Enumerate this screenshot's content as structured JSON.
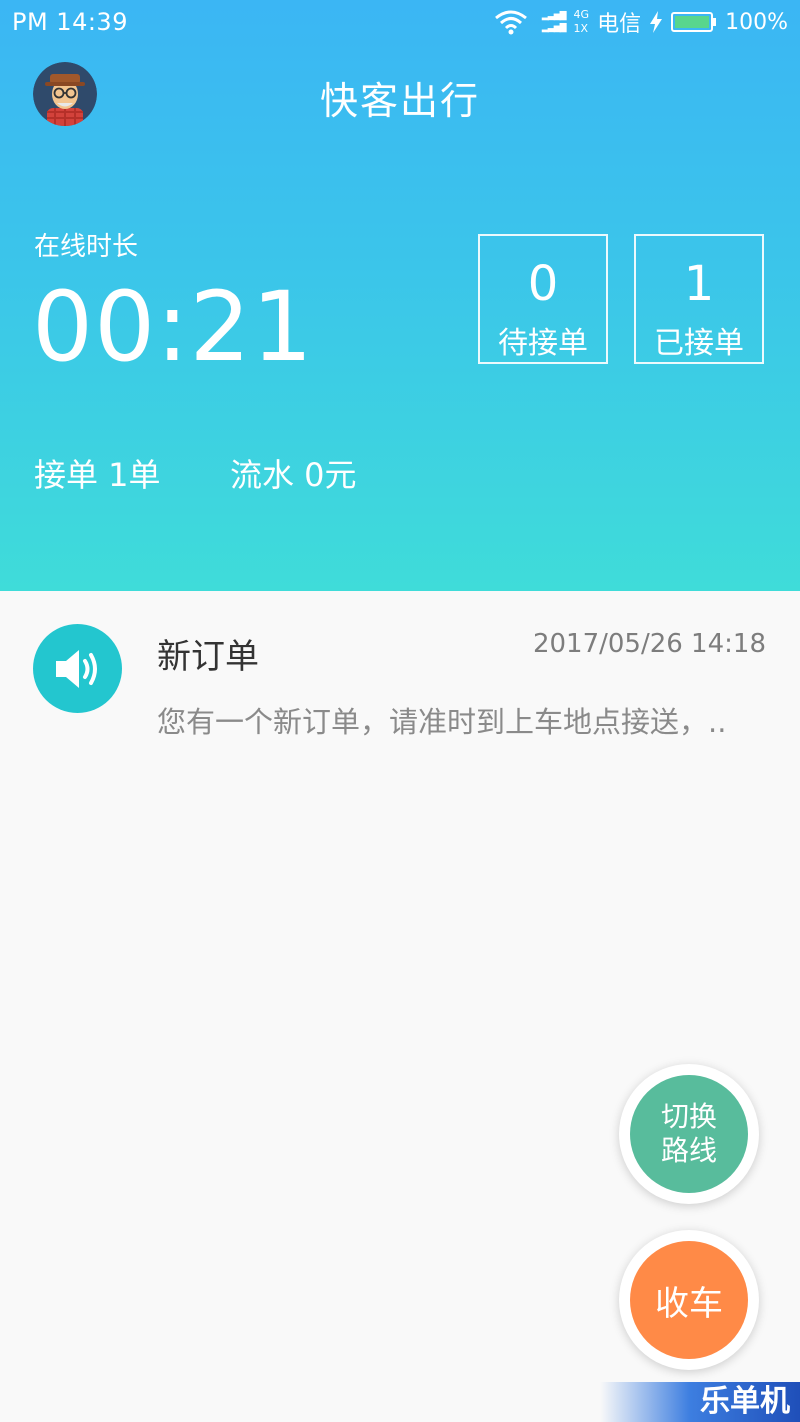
{
  "status_bar": {
    "time": "PM  14:39",
    "network_top": "4G",
    "network_bottom": "1X",
    "carrier": "电信",
    "battery": "100%"
  },
  "header": {
    "title": "快客出行",
    "online_label": "在线时长",
    "online_time": "00:21",
    "stats": [
      {
        "value": "0",
        "label": "待接单"
      },
      {
        "value": "1",
        "label": "已接单"
      }
    ],
    "orders_summary": "接单 1单",
    "flow_summary": "流水 0元"
  },
  "messages": [
    {
      "icon": "speaker-icon",
      "title": "新订单",
      "time": "2017/05/26 14:18",
      "body": "您有一个新订单，请准时到上车地点接送，.."
    }
  ],
  "buttons": {
    "switch_route": "切换\n路线",
    "stop": "收车"
  },
  "watermark": "乐单机",
  "colors": {
    "header_top": "#3bb6f4",
    "header_bottom": "#3fdcd9",
    "message_icon": "#23c6cf",
    "switch_route": "#58bc9c",
    "stop": "#ff8a47"
  }
}
